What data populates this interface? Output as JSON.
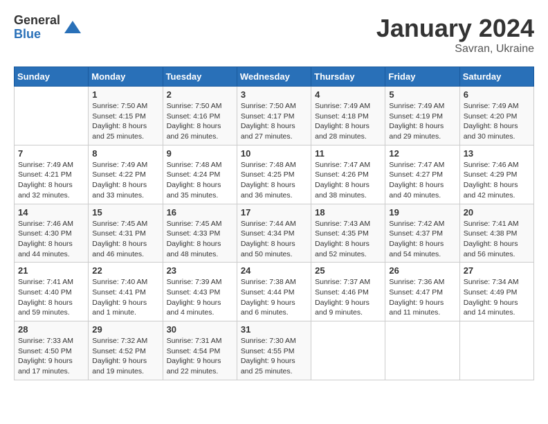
{
  "header": {
    "logo_general": "General",
    "logo_blue": "Blue",
    "month_title": "January 2024",
    "location": "Savran, Ukraine"
  },
  "weekdays": [
    "Sunday",
    "Monday",
    "Tuesday",
    "Wednesday",
    "Thursday",
    "Friday",
    "Saturday"
  ],
  "weeks": [
    [
      {
        "day": "",
        "sunrise": "",
        "sunset": "",
        "daylight": ""
      },
      {
        "day": "1",
        "sunrise": "Sunrise: 7:50 AM",
        "sunset": "Sunset: 4:15 PM",
        "daylight": "Daylight: 8 hours and 25 minutes."
      },
      {
        "day": "2",
        "sunrise": "Sunrise: 7:50 AM",
        "sunset": "Sunset: 4:16 PM",
        "daylight": "Daylight: 8 hours and 26 minutes."
      },
      {
        "day": "3",
        "sunrise": "Sunrise: 7:50 AM",
        "sunset": "Sunset: 4:17 PM",
        "daylight": "Daylight: 8 hours and 27 minutes."
      },
      {
        "day": "4",
        "sunrise": "Sunrise: 7:49 AM",
        "sunset": "Sunset: 4:18 PM",
        "daylight": "Daylight: 8 hours and 28 minutes."
      },
      {
        "day": "5",
        "sunrise": "Sunrise: 7:49 AM",
        "sunset": "Sunset: 4:19 PM",
        "daylight": "Daylight: 8 hours and 29 minutes."
      },
      {
        "day": "6",
        "sunrise": "Sunrise: 7:49 AM",
        "sunset": "Sunset: 4:20 PM",
        "daylight": "Daylight: 8 hours and 30 minutes."
      }
    ],
    [
      {
        "day": "7",
        "sunrise": "Sunrise: 7:49 AM",
        "sunset": "Sunset: 4:21 PM",
        "daylight": "Daylight: 8 hours and 32 minutes."
      },
      {
        "day": "8",
        "sunrise": "Sunrise: 7:49 AM",
        "sunset": "Sunset: 4:22 PM",
        "daylight": "Daylight: 8 hours and 33 minutes."
      },
      {
        "day": "9",
        "sunrise": "Sunrise: 7:48 AM",
        "sunset": "Sunset: 4:24 PM",
        "daylight": "Daylight: 8 hours and 35 minutes."
      },
      {
        "day": "10",
        "sunrise": "Sunrise: 7:48 AM",
        "sunset": "Sunset: 4:25 PM",
        "daylight": "Daylight: 8 hours and 36 minutes."
      },
      {
        "day": "11",
        "sunrise": "Sunrise: 7:47 AM",
        "sunset": "Sunset: 4:26 PM",
        "daylight": "Daylight: 8 hours and 38 minutes."
      },
      {
        "day": "12",
        "sunrise": "Sunrise: 7:47 AM",
        "sunset": "Sunset: 4:27 PM",
        "daylight": "Daylight: 8 hours and 40 minutes."
      },
      {
        "day": "13",
        "sunrise": "Sunrise: 7:46 AM",
        "sunset": "Sunset: 4:29 PM",
        "daylight": "Daylight: 8 hours and 42 minutes."
      }
    ],
    [
      {
        "day": "14",
        "sunrise": "Sunrise: 7:46 AM",
        "sunset": "Sunset: 4:30 PM",
        "daylight": "Daylight: 8 hours and 44 minutes."
      },
      {
        "day": "15",
        "sunrise": "Sunrise: 7:45 AM",
        "sunset": "Sunset: 4:31 PM",
        "daylight": "Daylight: 8 hours and 46 minutes."
      },
      {
        "day": "16",
        "sunrise": "Sunrise: 7:45 AM",
        "sunset": "Sunset: 4:33 PM",
        "daylight": "Daylight: 8 hours and 48 minutes."
      },
      {
        "day": "17",
        "sunrise": "Sunrise: 7:44 AM",
        "sunset": "Sunset: 4:34 PM",
        "daylight": "Daylight: 8 hours and 50 minutes."
      },
      {
        "day": "18",
        "sunrise": "Sunrise: 7:43 AM",
        "sunset": "Sunset: 4:35 PM",
        "daylight": "Daylight: 8 hours and 52 minutes."
      },
      {
        "day": "19",
        "sunrise": "Sunrise: 7:42 AM",
        "sunset": "Sunset: 4:37 PM",
        "daylight": "Daylight: 8 hours and 54 minutes."
      },
      {
        "day": "20",
        "sunrise": "Sunrise: 7:41 AM",
        "sunset": "Sunset: 4:38 PM",
        "daylight": "Daylight: 8 hours and 56 minutes."
      }
    ],
    [
      {
        "day": "21",
        "sunrise": "Sunrise: 7:41 AM",
        "sunset": "Sunset: 4:40 PM",
        "daylight": "Daylight: 8 hours and 59 minutes."
      },
      {
        "day": "22",
        "sunrise": "Sunrise: 7:40 AM",
        "sunset": "Sunset: 4:41 PM",
        "daylight": "Daylight: 9 hours and 1 minute."
      },
      {
        "day": "23",
        "sunrise": "Sunrise: 7:39 AM",
        "sunset": "Sunset: 4:43 PM",
        "daylight": "Daylight: 9 hours and 4 minutes."
      },
      {
        "day": "24",
        "sunrise": "Sunrise: 7:38 AM",
        "sunset": "Sunset: 4:44 PM",
        "daylight": "Daylight: 9 hours and 6 minutes."
      },
      {
        "day": "25",
        "sunrise": "Sunrise: 7:37 AM",
        "sunset": "Sunset: 4:46 PM",
        "daylight": "Daylight: 9 hours and 9 minutes."
      },
      {
        "day": "26",
        "sunrise": "Sunrise: 7:36 AM",
        "sunset": "Sunset: 4:47 PM",
        "daylight": "Daylight: 9 hours and 11 minutes."
      },
      {
        "day": "27",
        "sunrise": "Sunrise: 7:34 AM",
        "sunset": "Sunset: 4:49 PM",
        "daylight": "Daylight: 9 hours and 14 minutes."
      }
    ],
    [
      {
        "day": "28",
        "sunrise": "Sunrise: 7:33 AM",
        "sunset": "Sunset: 4:50 PM",
        "daylight": "Daylight: 9 hours and 17 minutes."
      },
      {
        "day": "29",
        "sunrise": "Sunrise: 7:32 AM",
        "sunset": "Sunset: 4:52 PM",
        "daylight": "Daylight: 9 hours and 19 minutes."
      },
      {
        "day": "30",
        "sunrise": "Sunrise: 7:31 AM",
        "sunset": "Sunset: 4:54 PM",
        "daylight": "Daylight: 9 hours and 22 minutes."
      },
      {
        "day": "31",
        "sunrise": "Sunrise: 7:30 AM",
        "sunset": "Sunset: 4:55 PM",
        "daylight": "Daylight: 9 hours and 25 minutes."
      },
      {
        "day": "",
        "sunrise": "",
        "sunset": "",
        "daylight": ""
      },
      {
        "day": "",
        "sunrise": "",
        "sunset": "",
        "daylight": ""
      },
      {
        "day": "",
        "sunrise": "",
        "sunset": "",
        "daylight": ""
      }
    ]
  ]
}
